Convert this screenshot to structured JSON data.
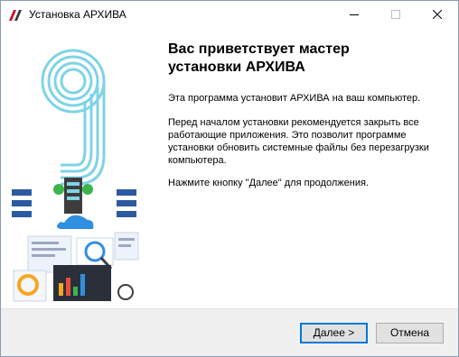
{
  "window": {
    "title": "Установка АРХИВА",
    "icons": {
      "app": "archive-logo-icon",
      "minimize": "minimize-icon",
      "maximize": "maximize-icon",
      "close": "close-icon"
    }
  },
  "main": {
    "heading_line1": "Вас приветствует мастер",
    "heading_line2": "установки АРХИВА",
    "paragraph1": "Эта программа установит АРХИВА на ваш компьютер.",
    "paragraph2": "Перед началом установки рекомендуется закрыть все работающие приложения. Это позволит программе установки обновить системные файлы без перезагрузки компьютера.",
    "paragraph3": "Нажмите кнопку \"Далее\" для продолжения."
  },
  "footer": {
    "next_label": "Далее >",
    "cancel_label": "Отмена"
  },
  "colors": {
    "accent_blue": "#0078d7",
    "logo_red": "#c8102e",
    "art_cyan": "#7fd3e6",
    "footer_bg": "#f0f0f0"
  }
}
